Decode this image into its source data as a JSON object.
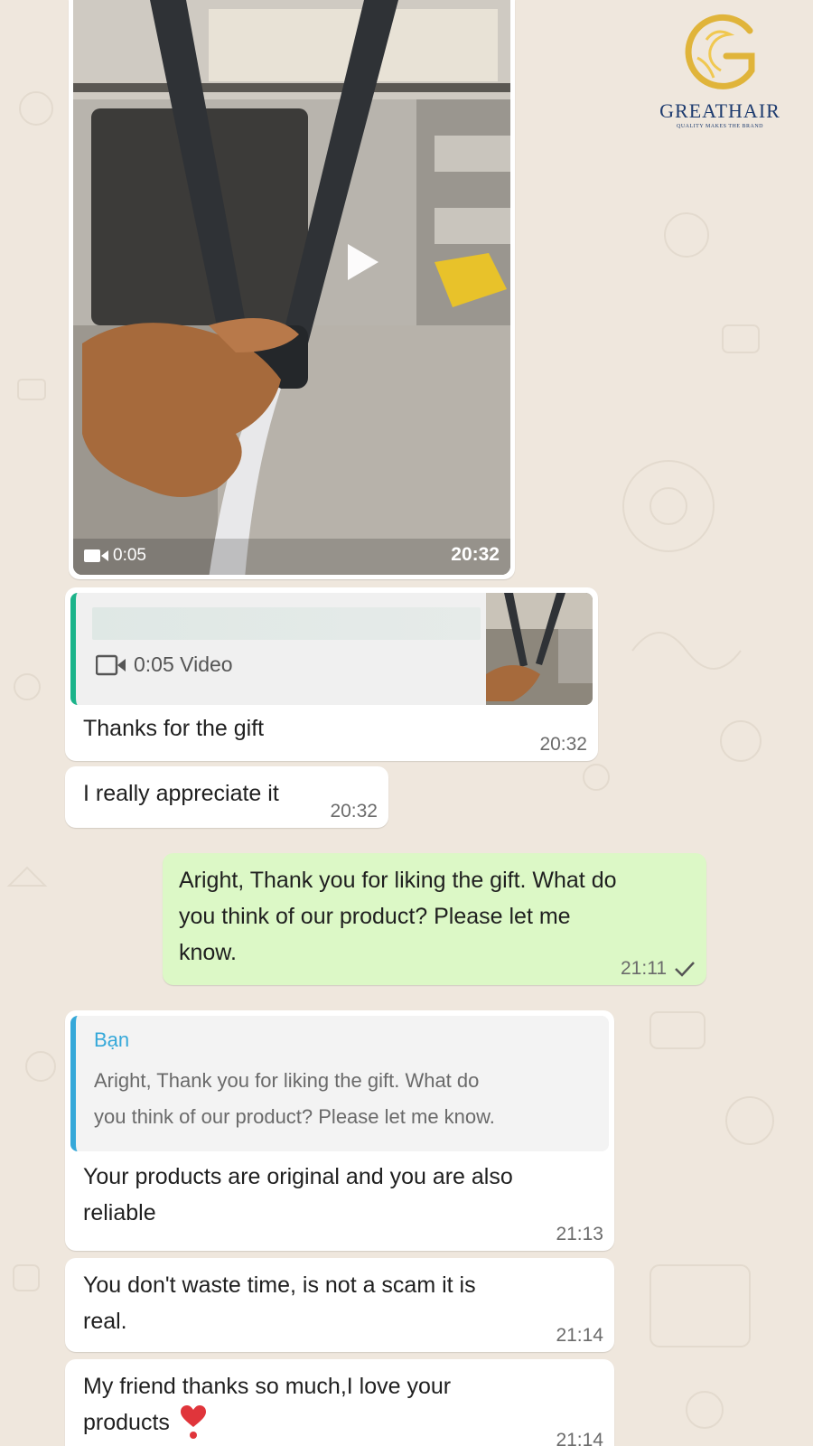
{
  "logo": {
    "name": "GREATHAIR",
    "tagline": "QUALITY MAKES THE BRAND"
  },
  "video_message": {
    "duration": "0:05",
    "time": "20:32",
    "icons": {
      "play": "play-icon",
      "video": "video-camera-icon"
    }
  },
  "messages": [
    {
      "direction": "incoming",
      "quoted": {
        "media_label": "0:05 Video",
        "icon": "video-camera-icon"
      },
      "text": "Thanks for the gift",
      "time": "20:32"
    },
    {
      "direction": "incoming",
      "text": "I really appreciate it",
      "time": "20:32"
    },
    {
      "direction": "outgoing",
      "text_lines": [
        "Aright, Thank you for liking the gift. What do",
        "you think of our product? Please let me",
        "know."
      ],
      "time": "21:11",
      "status_icon": "check-icon"
    },
    {
      "direction": "incoming",
      "quoted": {
        "author": "Bạn",
        "text_lines": [
          "Aright, Thank you for liking the gift. What do",
          "you think of our product? Please let me know."
        ]
      },
      "text_lines": [
        "Your products are original and you are also",
        "reliable"
      ],
      "time": "21:13"
    },
    {
      "direction": "incoming",
      "text_lines": [
        "You don't waste time, is not a scam it is",
        "real."
      ],
      "time": "21:14"
    },
    {
      "direction": "incoming",
      "text_lines": [
        "My friend thanks so much,I love your",
        "products"
      ],
      "emoji": "heart-exclamation-emoji",
      "time": "21:14"
    }
  ],
  "colors": {
    "chat_background": "#efe7dd",
    "incoming_bubble": "#ffffff",
    "outgoing_bubble": "#dcf8c6",
    "quote_bar_green": "#1bb38a",
    "quote_bar_blue": "#35a8d9",
    "logo_navy": "#1d3b6f",
    "logo_gold": "#e0b43a"
  }
}
